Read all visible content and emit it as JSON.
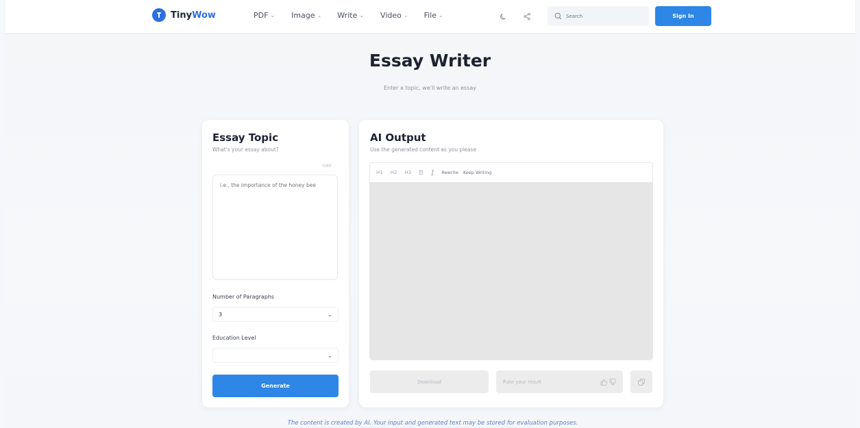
{
  "header": {
    "brand_part1": "Tiny",
    "brand_part2": "Wow",
    "nav": [
      {
        "label": "PDF"
      },
      {
        "label": "Image"
      },
      {
        "label": "Write"
      },
      {
        "label": "Video"
      },
      {
        "label": "File"
      }
    ],
    "search_placeholder": "Search",
    "signin_label": "Sign In"
  },
  "hero": {
    "title": "Essay Writer",
    "subtitle": "Enter a topic, we'll write an essay"
  },
  "input_panel": {
    "heading": "Essay Topic",
    "subheading": "What's your essay about?",
    "char_count": "0/80",
    "topic_placeholder": "i.e., the importance of the honey bee",
    "paragraphs_label": "Number of Paragraphs",
    "paragraphs_value": "3",
    "education_label": "Education Level",
    "education_value": "",
    "generate_label": "Generate"
  },
  "output_panel": {
    "heading": "AI Output",
    "subheading": "Use the generated content as you please",
    "toolbar": {
      "h1": "H1",
      "h2": "H2",
      "h3": "H3",
      "bold": "B",
      "italic": "I",
      "rewrite": "Rewrite",
      "keep_writing": "Keep Writing"
    },
    "download_label": "Download",
    "rate_label": "Rate your result"
  },
  "footnote": "The content is created by AI. Your input and generated text may be stored for evaluation purposes.",
  "colors": {
    "accent": "#2e86e6",
    "brand": "#2e6fe0"
  }
}
